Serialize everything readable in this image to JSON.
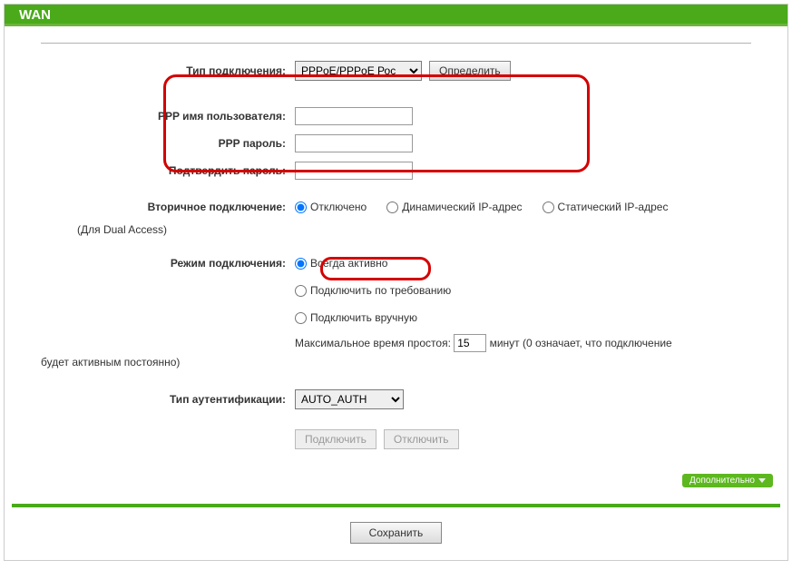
{
  "header": {
    "title": "WAN"
  },
  "connection_type": {
    "label": "Тип подключения:",
    "value": "PPPoE/PPPoE Рос",
    "detect_button": "Определить"
  },
  "ppp_username": {
    "label": "PPP имя пользователя:",
    "value": ""
  },
  "ppp_password": {
    "label": "PPP пароль:",
    "value": ""
  },
  "ppp_confirm": {
    "label": "Подтвердить пароль:",
    "value": ""
  },
  "secondary_conn": {
    "label": "Вторичное подключение:",
    "options": {
      "disabled": "Отключено",
      "dynamic": "Динамический IP-адрес",
      "static": "Статический IP-адрес"
    },
    "note": "(Для Dual Access)"
  },
  "conn_mode": {
    "label": "Режим подключения:",
    "options": {
      "always": "Всегда активно",
      "ondemand": "Подключить по требованию",
      "manual": "Подключить вручную"
    },
    "idle": {
      "prefix": "Максимальное время простоя:",
      "value": "15",
      "suffix_a": "минут (0 означает, что подключение",
      "suffix_b": "будет активным постоянно)"
    }
  },
  "auth_type": {
    "label": "Тип аутентификации:",
    "value": "AUTO_AUTH"
  },
  "buttons": {
    "connect": "Подключить",
    "disconnect": "Отключить",
    "save": "Сохранить"
  },
  "advanced_label": "Дополнительно"
}
